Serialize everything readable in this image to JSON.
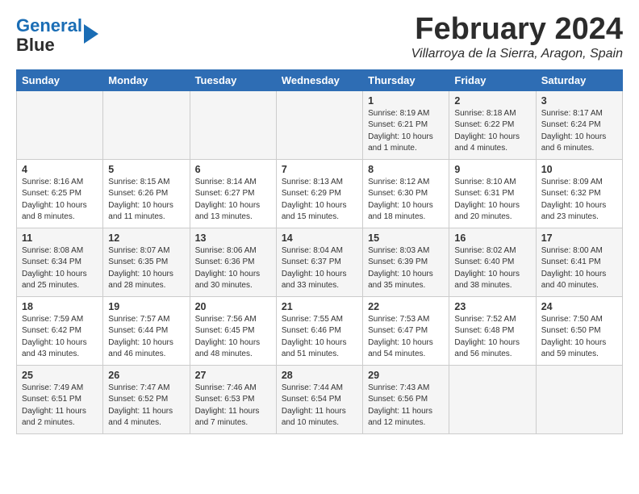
{
  "header": {
    "logo_line1": "General",
    "logo_line2": "Blue",
    "month_title": "February 2024",
    "location": "Villarroya de la Sierra, Aragon, Spain"
  },
  "weekdays": [
    "Sunday",
    "Monday",
    "Tuesday",
    "Wednesday",
    "Thursday",
    "Friday",
    "Saturday"
  ],
  "weeks": [
    [
      {
        "day": "",
        "content": ""
      },
      {
        "day": "",
        "content": ""
      },
      {
        "day": "",
        "content": ""
      },
      {
        "day": "",
        "content": ""
      },
      {
        "day": "1",
        "content": "Sunrise: 8:19 AM\nSunset: 6:21 PM\nDaylight: 10 hours\nand 1 minute."
      },
      {
        "day": "2",
        "content": "Sunrise: 8:18 AM\nSunset: 6:22 PM\nDaylight: 10 hours\nand 4 minutes."
      },
      {
        "day": "3",
        "content": "Sunrise: 8:17 AM\nSunset: 6:24 PM\nDaylight: 10 hours\nand 6 minutes."
      }
    ],
    [
      {
        "day": "4",
        "content": "Sunrise: 8:16 AM\nSunset: 6:25 PM\nDaylight: 10 hours\nand 8 minutes."
      },
      {
        "day": "5",
        "content": "Sunrise: 8:15 AM\nSunset: 6:26 PM\nDaylight: 10 hours\nand 11 minutes."
      },
      {
        "day": "6",
        "content": "Sunrise: 8:14 AM\nSunset: 6:27 PM\nDaylight: 10 hours\nand 13 minutes."
      },
      {
        "day": "7",
        "content": "Sunrise: 8:13 AM\nSunset: 6:29 PM\nDaylight: 10 hours\nand 15 minutes."
      },
      {
        "day": "8",
        "content": "Sunrise: 8:12 AM\nSunset: 6:30 PM\nDaylight: 10 hours\nand 18 minutes."
      },
      {
        "day": "9",
        "content": "Sunrise: 8:10 AM\nSunset: 6:31 PM\nDaylight: 10 hours\nand 20 minutes."
      },
      {
        "day": "10",
        "content": "Sunrise: 8:09 AM\nSunset: 6:32 PM\nDaylight: 10 hours\nand 23 minutes."
      }
    ],
    [
      {
        "day": "11",
        "content": "Sunrise: 8:08 AM\nSunset: 6:34 PM\nDaylight: 10 hours\nand 25 minutes."
      },
      {
        "day": "12",
        "content": "Sunrise: 8:07 AM\nSunset: 6:35 PM\nDaylight: 10 hours\nand 28 minutes."
      },
      {
        "day": "13",
        "content": "Sunrise: 8:06 AM\nSunset: 6:36 PM\nDaylight: 10 hours\nand 30 minutes."
      },
      {
        "day": "14",
        "content": "Sunrise: 8:04 AM\nSunset: 6:37 PM\nDaylight: 10 hours\nand 33 minutes."
      },
      {
        "day": "15",
        "content": "Sunrise: 8:03 AM\nSunset: 6:39 PM\nDaylight: 10 hours\nand 35 minutes."
      },
      {
        "day": "16",
        "content": "Sunrise: 8:02 AM\nSunset: 6:40 PM\nDaylight: 10 hours\nand 38 minutes."
      },
      {
        "day": "17",
        "content": "Sunrise: 8:00 AM\nSunset: 6:41 PM\nDaylight: 10 hours\nand 40 minutes."
      }
    ],
    [
      {
        "day": "18",
        "content": "Sunrise: 7:59 AM\nSunset: 6:42 PM\nDaylight: 10 hours\nand 43 minutes."
      },
      {
        "day": "19",
        "content": "Sunrise: 7:57 AM\nSunset: 6:44 PM\nDaylight: 10 hours\nand 46 minutes."
      },
      {
        "day": "20",
        "content": "Sunrise: 7:56 AM\nSunset: 6:45 PM\nDaylight: 10 hours\nand 48 minutes."
      },
      {
        "day": "21",
        "content": "Sunrise: 7:55 AM\nSunset: 6:46 PM\nDaylight: 10 hours\nand 51 minutes."
      },
      {
        "day": "22",
        "content": "Sunrise: 7:53 AM\nSunset: 6:47 PM\nDaylight: 10 hours\nand 54 minutes."
      },
      {
        "day": "23",
        "content": "Sunrise: 7:52 AM\nSunset: 6:48 PM\nDaylight: 10 hours\nand 56 minutes."
      },
      {
        "day": "24",
        "content": "Sunrise: 7:50 AM\nSunset: 6:50 PM\nDaylight: 10 hours\nand 59 minutes."
      }
    ],
    [
      {
        "day": "25",
        "content": "Sunrise: 7:49 AM\nSunset: 6:51 PM\nDaylight: 11 hours\nand 2 minutes."
      },
      {
        "day": "26",
        "content": "Sunrise: 7:47 AM\nSunset: 6:52 PM\nDaylight: 11 hours\nand 4 minutes."
      },
      {
        "day": "27",
        "content": "Sunrise: 7:46 AM\nSunset: 6:53 PM\nDaylight: 11 hours\nand 7 minutes."
      },
      {
        "day": "28",
        "content": "Sunrise: 7:44 AM\nSunset: 6:54 PM\nDaylight: 11 hours\nand 10 minutes."
      },
      {
        "day": "29",
        "content": "Sunrise: 7:43 AM\nSunset: 6:56 PM\nDaylight: 11 hours\nand 12 minutes."
      },
      {
        "day": "",
        "content": ""
      },
      {
        "day": "",
        "content": ""
      }
    ]
  ]
}
